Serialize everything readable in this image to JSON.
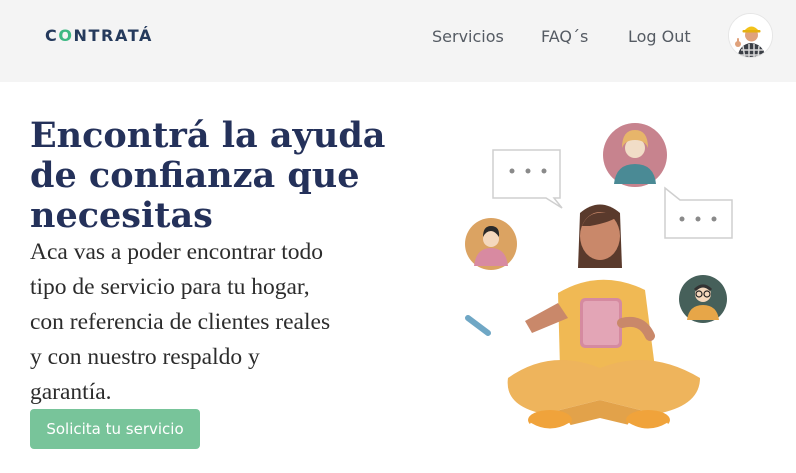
{
  "nav": {
    "logo_pre": "C",
    "logo_o": "O",
    "logo_post": "NTRATÁ",
    "links": [
      "Servicios",
      "FAQ´s",
      "Log Out"
    ]
  },
  "hero": {
    "title_lines": [
      "Encontrá la ayuda",
      "de confianza que",
      "necesitas"
    ],
    "text_lines": [
      "Aca vas a poder encontrar todo",
      "tipo de servicio para tu hogar,",
      "con referencia de clientes reales",
      "y con nuestro respaldo y",
      "garantía."
    ],
    "cta_label": "Solicita tu servicio"
  },
  "colors": {
    "navbar_bg": "#f4f4f4",
    "logo": "#253a5c",
    "logo_accent": "#3db883",
    "title": "#24315a",
    "cta": "#78c49a"
  },
  "icons": {
    "avatar": "worker-avatar",
    "illustration": "person-with-tablet-illustration"
  }
}
